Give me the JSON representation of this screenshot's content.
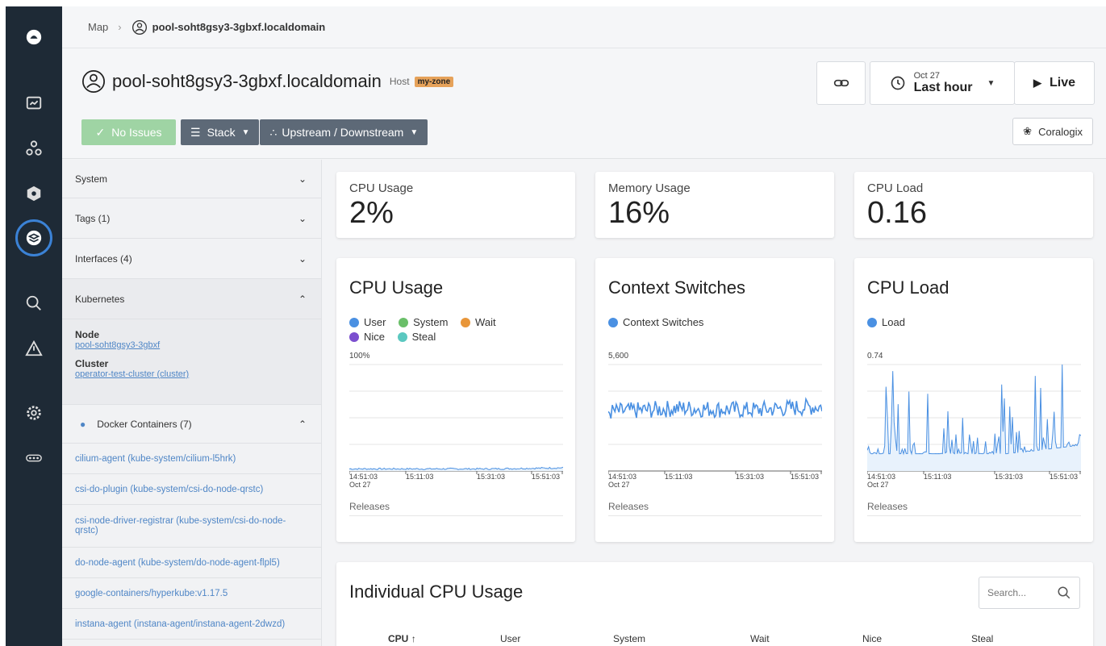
{
  "breadcrumb": {
    "map": "Map",
    "host": "pool-soht8gsy3-3gbxf.localdomain"
  },
  "header": {
    "title": "pool-soht8gsy3-3gbxf.localdomain",
    "type": "Host",
    "zone": "my-zone",
    "no_issues": "No Issues",
    "stack": "Stack",
    "upstream": "Upstream / Downstream",
    "time_date": "Oct 27",
    "time_range": "Last hour",
    "live": "Live",
    "coralogix": "Coralogix"
  },
  "sidebar": {
    "sections": [
      {
        "label": "System",
        "state": "collapsed"
      },
      {
        "label": "Tags (1)",
        "state": "collapsed"
      },
      {
        "label": "Interfaces (4)",
        "state": "collapsed"
      },
      {
        "label": "Kubernetes",
        "state": "expanded"
      }
    ],
    "kubernetes": {
      "node_label": "Node",
      "node_value": "pool-soht8gsy3-3gbxf",
      "cluster_label": "Cluster",
      "cluster_value": "operator-test-cluster (cluster)"
    },
    "docker_label": "Docker Containers (7)",
    "containers": [
      "cilium-agent (kube-system/cilium-l5hrk)",
      "csi-do-plugin (kube-system/csi-do-node-qrstc)",
      "csi-node-driver-registrar (kube-system/csi-do-node-qrstc)",
      "do-node-agent (kube-system/do-node-agent-flpl5)",
      "google-containers/hyperkube:v1.17.5",
      "instana-agent (instana-agent/instana-agent-2dwzd)"
    ]
  },
  "stats": [
    {
      "label": "CPU Usage",
      "value": "2%"
    },
    {
      "label": "Memory Usage",
      "value": "16%"
    },
    {
      "label": "CPU Load",
      "value": "0.16"
    }
  ],
  "charts": {
    "cpu": {
      "title": "CPU Usage",
      "legend": [
        "User",
        "System",
        "Wait",
        "Nice",
        "Steal"
      ],
      "ymax": "100%"
    },
    "ctx": {
      "title": "Context Switches",
      "legend": [
        "Context Switches"
      ],
      "ymax": "5,600"
    },
    "load": {
      "title": "CPU Load",
      "legend": [
        "Load"
      ],
      "ymax": "0.74"
    },
    "ticks": [
      "14:51:03",
      "15:11:03",
      "15:31:03",
      "15:51:03"
    ],
    "tick_date": "Oct 27",
    "releases": "Releases"
  },
  "colors": {
    "user": "#4a90e2",
    "system": "#6abf69",
    "wait": "#e8963a",
    "nice": "#7b4fcf",
    "steal": "#5bc8c0",
    "line": "#4a90e2"
  },
  "chart_data": [
    {
      "type": "area",
      "title": "CPU Usage",
      "x": [
        "14:51:03",
        "15:11:03",
        "15:31:03",
        "15:51:03"
      ],
      "ylim": [
        0,
        100
      ],
      "series": [
        {
          "name": "User",
          "values": [
            2,
            2,
            2,
            3
          ]
        }
      ]
    },
    {
      "type": "line",
      "title": "Context Switches",
      "x": [
        "14:51:03",
        "15:11:03",
        "15:31:03",
        "15:51:03"
      ],
      "ylim": [
        0,
        5600
      ],
      "series": [
        {
          "name": "Context Switches",
          "values": [
            3100,
            3300,
            3200,
            3400
          ]
        }
      ]
    },
    {
      "type": "area",
      "title": "CPU Load",
      "x": [
        "14:51:03",
        "15:11:03",
        "15:31:03",
        "15:51:03"
      ],
      "ylim": [
        0,
        0.74
      ],
      "series": [
        {
          "name": "Load",
          "values": [
            0.2,
            0.2,
            0.2,
            0.3
          ]
        }
      ]
    }
  ],
  "individual": {
    "title": "Individual CPU Usage",
    "search_placeholder": "Search...",
    "columns": [
      "CPU",
      "User",
      "System",
      "Wait",
      "Nice",
      "Steal"
    ]
  }
}
